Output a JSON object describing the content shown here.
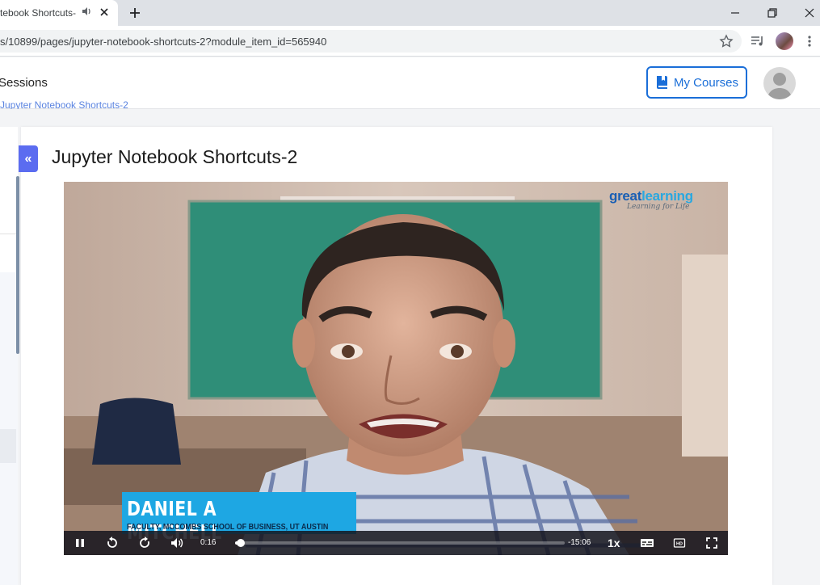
{
  "browser": {
    "tab_title": "tebook Shortcuts-",
    "url": "s/10899/pages/jupyter-notebook-shortcuts-2?module_item_id=565940"
  },
  "header": {
    "nav_item": "Sessions",
    "my_courses_label": "My Courses"
  },
  "breadcrumb": "Jupyter Notebook Shortcuts-2",
  "page": {
    "collapse_glyph": "«",
    "title": "Jupyter Notebook Shortcuts-2"
  },
  "video": {
    "logo_main_left": "great",
    "logo_main_right": "learning",
    "logo_tagline": "Learning for Life",
    "presenter_name": "DANIEL A MITCHELL",
    "presenter_title": "FACULTY, MCCOMBS SCHOOL OF BUSINESS, UT AUSTIN",
    "current_time": "0:16",
    "remaining_time": "-15:06",
    "speed": "1x",
    "progress_fraction": 0.018,
    "colors": {
      "logo_blue": "#1a5fb4",
      "logo_light": "#2aa8e0",
      "lower_third": "#1ea7e3"
    }
  },
  "icons": [
    "audio-playing-icon",
    "close-icon",
    "new-tab-icon",
    "minimize-icon",
    "restore-icon",
    "window-close-icon",
    "star-icon",
    "media-queue-icon",
    "kebab-menu-icon",
    "book-icon",
    "avatar-icon",
    "pause-icon",
    "rewind-icon",
    "forward-icon",
    "volume-icon",
    "captions-icon",
    "hd-icon",
    "fullscreen-icon"
  ]
}
